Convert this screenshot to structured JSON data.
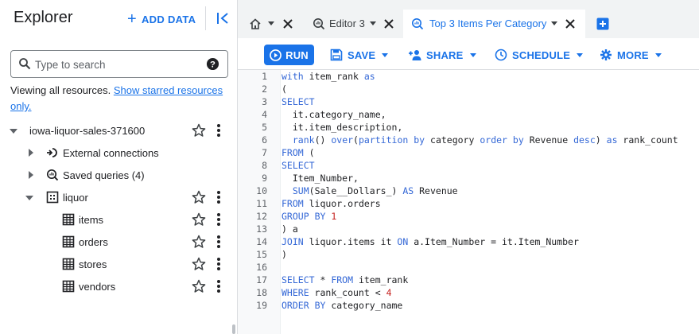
{
  "explorer": {
    "title": "Explorer",
    "add_data_label": "ADD DATA",
    "search_placeholder": "Type to search",
    "viewing_text": "Viewing all resources.",
    "starred_link": "Show starred resources only.",
    "tree": [
      {
        "label": "iowa-liquor-sales-371600",
        "icon": "project",
        "expanded": true,
        "starred_action": true
      },
      {
        "label": "External connections",
        "icon": "external-connections-icon",
        "expanded": false
      },
      {
        "label": "Saved queries (4)",
        "icon": "saved-queries-icon",
        "expanded": false
      },
      {
        "label": "liquor",
        "icon": "dataset-icon",
        "expanded": true,
        "starred_action": true
      },
      {
        "label": "items",
        "icon": "table-icon",
        "starred_action": true
      },
      {
        "label": "orders",
        "icon": "table-icon",
        "starred_action": true
      },
      {
        "label": "stores",
        "icon": "table-icon",
        "starred_action": true
      },
      {
        "label": "vendors",
        "icon": "table-icon",
        "starred_action": true
      }
    ]
  },
  "tabs": [
    {
      "label": "",
      "icon": "home-icon",
      "active": false
    },
    {
      "label": "Editor 3",
      "icon": "query-icon",
      "active": false
    },
    {
      "label": "Top 3 Items Per Category",
      "icon": "query-icon",
      "active": true
    }
  ],
  "toolbar": {
    "run_label": "RUN",
    "save_label": "SAVE",
    "share_label": "SHARE",
    "schedule_label": "SCHEDULE",
    "more_label": "MORE"
  },
  "editor": {
    "line_numbers": [
      "1",
      "2",
      "3",
      "4",
      "5",
      "6",
      "7",
      "8",
      "9",
      "10",
      "11",
      "12",
      "13",
      "14",
      "15",
      "16",
      "17",
      "18",
      "19"
    ],
    "lines": [
      "with item_rank as",
      "(",
      "SELECT",
      "  it.category_name,",
      "  it.item_description,",
      "  rank() over(partition by category order by Revenue desc) as rank_count",
      "FROM (",
      "SELECT",
      "  Item_Number,",
      "  SUM(Sale__Dollars_) AS Revenue",
      "FROM liquor.orders",
      "GROUP BY 1",
      ") a",
      "JOIN liquor.items it ON a.Item_Number = it.Item_Number",
      ")",
      "",
      "SELECT * FROM item_rank",
      "WHERE rank_count < 4",
      "ORDER BY category_name"
    ]
  },
  "colors": {
    "accent": "#1a73e8",
    "keyword": "#3367d6",
    "number": "#c5221f",
    "tabbar_bg": "#f1f3f4"
  }
}
